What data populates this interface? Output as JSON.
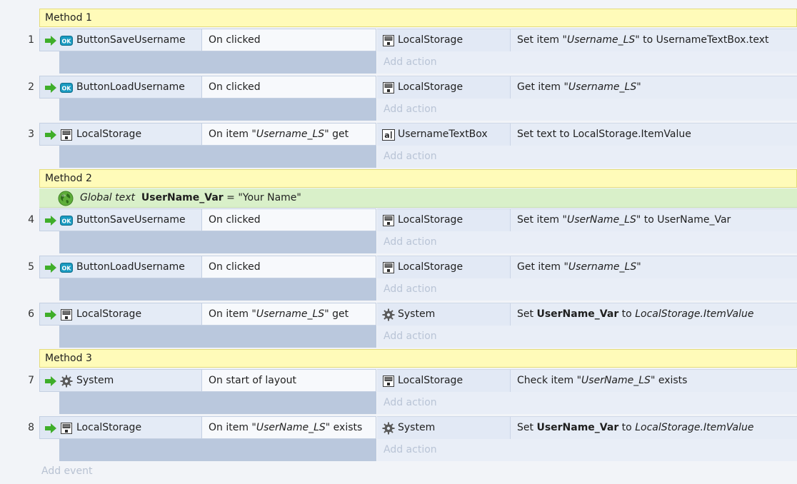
{
  "groups": [
    {
      "title": "Method 1"
    },
    {
      "title": "Method 2",
      "global_var": {
        "prefix": "Global text",
        "name": "UserName_Var",
        "equals": " = ",
        "value": "\"Your Name\""
      }
    },
    {
      "title": "Method 3"
    }
  ],
  "events": [
    {
      "num": "1",
      "object": "ButtonSaveUsername",
      "object_icon": "button-icon",
      "trigger": "On clicked",
      "action_object": "LocalStorage",
      "action_icon": "localstorage-icon",
      "action": {
        "pre": "Set item \"",
        "it": "Username_LS",
        "post": "\" to UsernameTextBox.text"
      }
    },
    {
      "num": "2",
      "object": "ButtonLoadUsername",
      "object_icon": "button-icon",
      "trigger": "On clicked",
      "action_object": "LocalStorage",
      "action_icon": "localstorage-icon",
      "action": {
        "pre": "Get item \"",
        "it": "Username_LS",
        "post": "\""
      }
    },
    {
      "num": "3",
      "object": "LocalStorage",
      "object_icon": "localstorage-icon",
      "trigger": {
        "pre": "On item \"",
        "it": "Username_LS",
        "post": "\" get"
      },
      "action_object": "UsernameTextBox",
      "action_icon": "textbox-icon",
      "action": {
        "text": "Set text to LocalStorage.ItemValue"
      }
    },
    {
      "num": "4",
      "object": "ButtonSaveUsername",
      "object_icon": "button-icon",
      "trigger": "On clicked",
      "action_object": "LocalStorage",
      "action_icon": "localstorage-icon",
      "action": {
        "pre": "Set item \"",
        "it": "UserName_LS",
        "post": "\" to UserName_Var"
      }
    },
    {
      "num": "5",
      "object": "ButtonLoadUsername",
      "object_icon": "button-icon",
      "trigger": "On clicked",
      "action_object": "LocalStorage",
      "action_icon": "localstorage-icon",
      "action": {
        "pre": "Get item \"",
        "it": "Username_LS",
        "post": "\""
      }
    },
    {
      "num": "6",
      "object": "LocalStorage",
      "object_icon": "localstorage-icon",
      "trigger": {
        "pre": "On item \"",
        "it": "Username_LS",
        "post": "\" get"
      },
      "action_object": "System",
      "action_icon": "gear-icon",
      "action": {
        "set": "Set ",
        "var": "UserName_Var",
        "to": " to ",
        "val": "LocalStorage.ItemValue"
      }
    },
    {
      "num": "7",
      "object": "System",
      "object_icon": "gear-icon",
      "trigger": "On start of layout",
      "action_object": "LocalStorage",
      "action_icon": "localstorage-icon",
      "action": {
        "pre": "Check item \"",
        "it": "UserName_LS",
        "post": "\" exists"
      }
    },
    {
      "num": "8",
      "object": "LocalStorage",
      "object_icon": "localstorage-icon",
      "trigger": {
        "pre": "On item \"",
        "it": "UserName_LS",
        "post": "\" exists"
      },
      "action_object": "System",
      "action_icon": "gear-icon",
      "action": {
        "set": "Set ",
        "var": "UserName_Var",
        "to": " to ",
        "val": "LocalStorage.ItemValue"
      }
    }
  ],
  "labels": {
    "add_action": "Add action",
    "add_event": "Add event"
  },
  "colors": {
    "group_header": "#fffbb9",
    "global_var": "#d9f0c9",
    "event_bg": "#dfe7f3",
    "sub_event": "#bac8dd",
    "arrow": "#3fae2a"
  }
}
